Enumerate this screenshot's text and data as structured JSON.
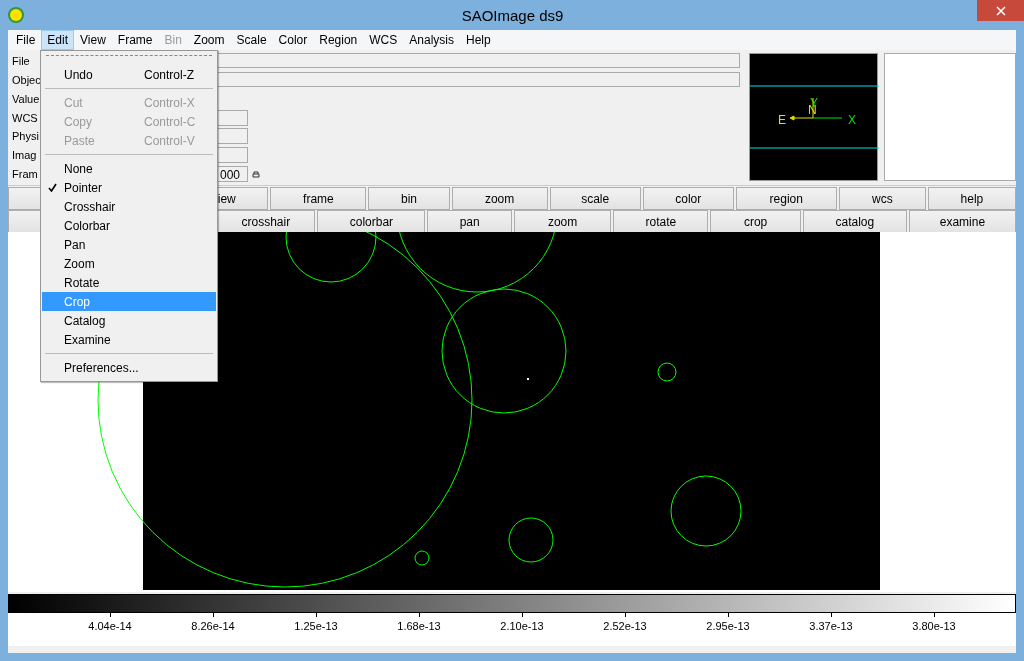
{
  "window": {
    "title": "SAOImage ds9"
  },
  "menubar": [
    {
      "label": "File",
      "selected": false,
      "disabled": false
    },
    {
      "label": "Edit",
      "selected": true,
      "disabled": false
    },
    {
      "label": "View",
      "selected": false,
      "disabled": false
    },
    {
      "label": "Frame",
      "selected": false,
      "disabled": false
    },
    {
      "label": "Bin",
      "selected": false,
      "disabled": true
    },
    {
      "label": "Zoom",
      "selected": false,
      "disabled": false
    },
    {
      "label": "Scale",
      "selected": false,
      "disabled": false
    },
    {
      "label": "Color",
      "selected": false,
      "disabled": false
    },
    {
      "label": "Region",
      "selected": false,
      "disabled": false
    },
    {
      "label": "WCS",
      "selected": false,
      "disabled": false
    },
    {
      "label": "Analysis",
      "selected": false,
      "disabled": false
    },
    {
      "label": "Help",
      "selected": false,
      "disabled": false
    }
  ],
  "info_panel": {
    "rows": [
      {
        "label": "File",
        "kind": "wide"
      },
      {
        "label": "Objec",
        "kind": "wide"
      },
      {
        "label": "Value",
        "kind": "none"
      },
      {
        "label": "WCS",
        "kind": "short"
      },
      {
        "label": "Physi",
        "kind": "short"
      },
      {
        "label": "Imag",
        "kind": "short"
      },
      {
        "label": "Fram",
        "kind": "short",
        "value": "000"
      }
    ]
  },
  "panner": {
    "compass": {
      "y": "Y",
      "n": "N",
      "e": "E",
      "x": "X"
    }
  },
  "button_bar": {
    "row_1": [
      {
        "kind": "blank"
      },
      {
        "label": "iew"
      },
      {
        "label": "frame"
      },
      {
        "label": "bin"
      },
      {
        "label": "zoom"
      },
      {
        "label": "scale"
      },
      {
        "label": "color"
      },
      {
        "label": "region"
      },
      {
        "label": "wcs"
      },
      {
        "label": "help"
      }
    ],
    "row_2": [
      {
        "kind": "blank"
      },
      {
        "label": "crosshair"
      },
      {
        "label": "colorbar"
      },
      {
        "label": "pan"
      },
      {
        "label": "zoom"
      },
      {
        "label": "rotate"
      },
      {
        "label": "crop"
      },
      {
        "label": "catalog"
      },
      {
        "label": "examine"
      }
    ]
  },
  "colorbar": {
    "ticks": [
      "4.04e-14",
      "8.26e-14",
      "1.25e-13",
      "1.68e-13",
      "2.10e-13",
      "2.52e-13",
      "2.95e-13",
      "3.37e-13",
      "3.80e-13"
    ]
  },
  "edit_menu": {
    "items": [
      {
        "kind": "item",
        "label": "Undo",
        "shortcut": "Control-Z",
        "disabled": false
      },
      {
        "kind": "separator"
      },
      {
        "kind": "item",
        "label": "Cut",
        "shortcut": "Control-X",
        "disabled": true
      },
      {
        "kind": "item",
        "label": "Copy",
        "shortcut": "Control-C",
        "disabled": true
      },
      {
        "kind": "item",
        "label": "Paste",
        "shortcut": "Control-V",
        "disabled": true
      },
      {
        "kind": "separator"
      },
      {
        "kind": "mode",
        "label": "None",
        "checked": false,
        "selected": false
      },
      {
        "kind": "mode",
        "label": "Pointer",
        "checked": true,
        "selected": false
      },
      {
        "kind": "mode",
        "label": "Crosshair",
        "checked": false,
        "selected": false
      },
      {
        "kind": "mode",
        "label": "Colorbar",
        "checked": false,
        "selected": false
      },
      {
        "kind": "mode",
        "label": "Pan",
        "checked": false,
        "selected": false
      },
      {
        "kind": "mode",
        "label": "Zoom",
        "checked": false,
        "selected": false
      },
      {
        "kind": "mode",
        "label": "Rotate",
        "checked": false,
        "selected": false
      },
      {
        "kind": "mode",
        "label": "Crop",
        "checked": false,
        "selected": true
      },
      {
        "kind": "mode",
        "label": "Catalog",
        "checked": false,
        "selected": false
      },
      {
        "kind": "mode",
        "label": "Examine",
        "checked": false,
        "selected": false
      },
      {
        "kind": "separator"
      },
      {
        "kind": "item",
        "label": "Preferences...",
        "disabled": false
      }
    ]
  }
}
